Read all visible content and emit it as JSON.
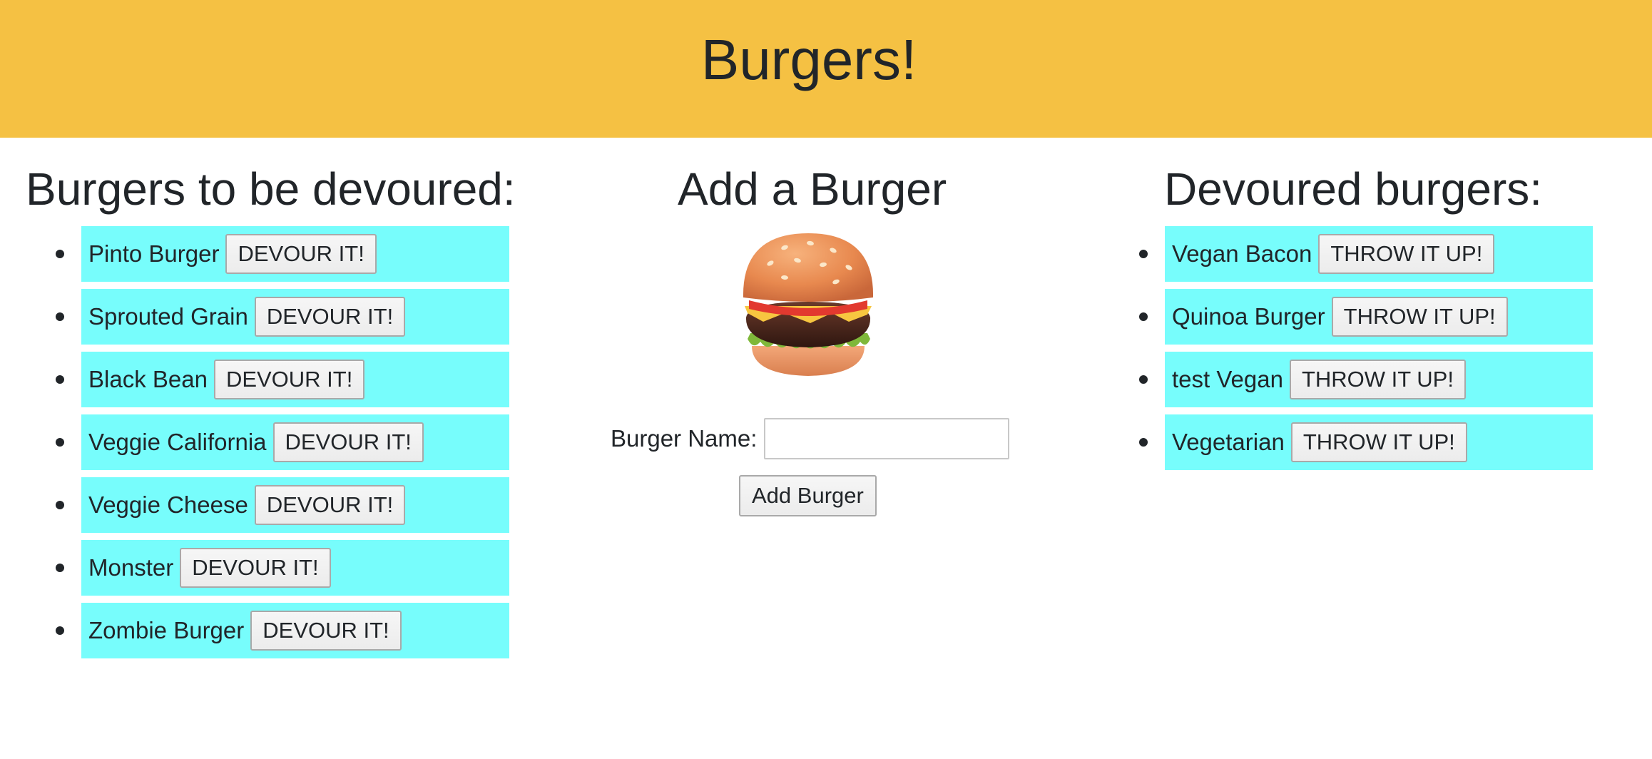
{
  "header": {
    "title": "Burgers!"
  },
  "to_devour": {
    "title": "Burgers to be devoured:",
    "button_label": "DEVOUR IT!",
    "items": [
      {
        "name": "Pinto Burger"
      },
      {
        "name": "Sprouted Grain"
      },
      {
        "name": "Black Bean"
      },
      {
        "name": "Veggie California"
      },
      {
        "name": "Veggie Cheese"
      },
      {
        "name": "Monster"
      },
      {
        "name": "Zombie Burger"
      }
    ]
  },
  "add": {
    "title": "Add a Burger",
    "image_icon": "hamburger-icon",
    "label": "Burger Name:",
    "input_value": "",
    "button_label": "Add Burger"
  },
  "devoured": {
    "title": "Devoured burgers:",
    "button_label": "THROW IT UP!",
    "items": [
      {
        "name": "Vegan Bacon"
      },
      {
        "name": "Quinoa Burger"
      },
      {
        "name": "test Vegan"
      },
      {
        "name": "Vegetarian"
      }
    ]
  },
  "colors": {
    "header_bg": "#f5c143",
    "item_bg": "#77fdfc"
  }
}
